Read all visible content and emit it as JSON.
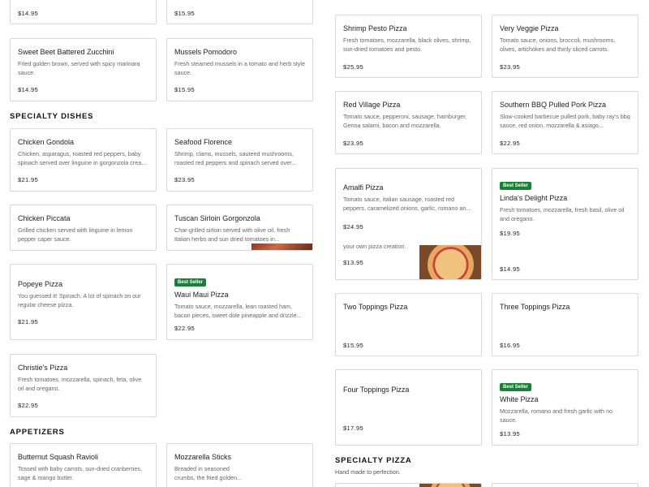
{
  "left": {
    "top_cards": [
      {
        "price": "$14.95"
      },
      {
        "price": "$15.95"
      }
    ],
    "cards_row2": [
      {
        "name": "Sweet Beet Battered Zucchini",
        "desc": "Fried golden brown, served with spicy marinara sauce.",
        "price": "$14.95"
      },
      {
        "name": "Mussels Pomodoro",
        "desc": "Fresh steamed mussels in a tomato and herb style sauce.",
        "price": "$15.95"
      }
    ],
    "specialty_dishes_title": "SPECIALTY DISHES",
    "specialty_dishes": [
      {
        "name": "Chicken Gondola",
        "desc": "Chicken, asparagus, roasted red peppers, baby spinach served over linguine in gorgonzola crea...",
        "price": "$21.95"
      },
      {
        "name": "Seafood Florence",
        "desc": "Shrimp, clams, mussels, sauteed mushrooms, roasted red peppers and spinach served over...",
        "price": "$23.95"
      },
      {
        "name": "Chicken Piccata",
        "desc": "Grilled chicken served with linguine in lemon pepper caper sauce.",
        "price": ""
      },
      {
        "name": "Tuscan Sirloin Gorgonzola",
        "desc": "Char-grilled sirloin served with olive oil, fresh Italian herbs and sun dried tomatoes in...",
        "price": ""
      },
      {
        "name": "Popeye Pizza",
        "desc": "You guessed it! Spinach. A lot of spinach on our regular cheese pizza.",
        "price": "$21.95"
      },
      {
        "name": "Waui Maui Pizza",
        "badge": "Best Seller",
        "desc": "Tomato sauce, mozzarella, lean roasted ham, bacon pieces, sweet dole pineapple and drizzle...",
        "price": "$22.95"
      },
      {
        "name": "Christie's Pizza",
        "desc": "Fresh tomatoes, mozzarella, spinach, feta, olive oil and oregano.",
        "price": "$22.95"
      }
    ],
    "appetizers_title": "APPETIZERS",
    "appetizers": [
      {
        "name": "Butternut Squash Ravioli",
        "desc": "Tossed with baby carrots, sun-dried cranberries, sage & mango butter.",
        "price": ""
      },
      {
        "name": "Mozzarella Sticks",
        "desc": "Breaded in seasoned crumbs, the fried golden...",
        "price": ""
      }
    ]
  },
  "right": {
    "cards": [
      {
        "name": "Shrimp Pesto Pizza",
        "desc": "Fresh tomatoes, mozzarella, black olives, shrimp, sun-dried tomatoes and pesto.",
        "price": "$25.95"
      },
      {
        "name": "Very Veggie Pizza",
        "desc": "Tomato sauce, onions, broccoli, mushrooms, olives, artichokes and thinly sliced carrots.",
        "price": "$23.95"
      },
      {
        "name": "Red Village Pizza",
        "desc": "Tomato sauce, pepperoni, sausage, hamburger, Genoa salami, bacon and mozzarella.",
        "price": "$23.95"
      },
      {
        "name": "Southern BBQ Pulled Pork Pizza",
        "desc": "Slow-cooked barbecue pulled pork, baby ray's bbq sauce, red onion, mozzarella & asiago...",
        "price": "$22.95"
      },
      {
        "name": "Amalfi Pizza",
        "desc": "Tomato sauce, italian sausage, roasted red peppers, caramelized onions, garlic, romano an...",
        "price": "$24.95"
      },
      {
        "name": "Linda's Delight Pizza",
        "badge": "Best Seller",
        "desc": "Fresh tomatoes, mozzarella, fresh basil, olive oil and oregano.",
        "price": "$19.95"
      },
      {
        "name": "",
        "desc": "your own pizza creation.",
        "price": "$13.95"
      },
      {
        "name": "",
        "desc": "",
        "price": "$14.95"
      },
      {
        "name": "Two Toppings Pizza",
        "desc": "",
        "price": "$15.95"
      },
      {
        "name": "Three Toppings Pizza",
        "desc": "",
        "price": "$16.95"
      },
      {
        "name": "Four Toppings Pizza",
        "desc": "",
        "price": "$17.95"
      },
      {
        "name": "White Pizza",
        "badge": "Best Seller",
        "desc": "Mozzarella, romano and fresh garlic with no sauce.",
        "price": "$13.95"
      }
    ],
    "specialty_pizza_title": "SPECIALTY PIZZA",
    "specialty_pizza_sub": "Hand made to perfection."
  }
}
